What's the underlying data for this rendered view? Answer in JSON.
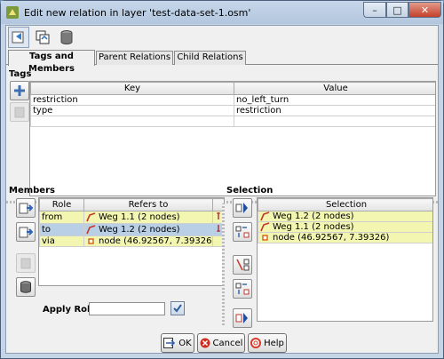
{
  "window": {
    "title": "Edit new relation in layer 'test-data-set-1.osm'"
  },
  "window_controls": {
    "minimize": "–",
    "maximize": "□",
    "close": "✕"
  },
  "toolbar": {
    "icons": [
      "apply-changes-icon",
      "refresh-icon",
      "delete-db-icon"
    ]
  },
  "tabs": [
    {
      "label": "Tags and Members"
    },
    {
      "label": "Parent Relations"
    },
    {
      "label": "Child Relations"
    }
  ],
  "tags": {
    "label": "Tags",
    "columns": [
      "Key",
      "Value"
    ],
    "rows": [
      {
        "key": "restriction",
        "value": "no_left_turn"
      },
      {
        "key": "type",
        "value": "restriction"
      }
    ]
  },
  "members": {
    "label": "Members",
    "columns": [
      "Role",
      "Refers to"
    ],
    "rows": [
      {
        "role": "from",
        "ref": "Weg 1.1 (2 nodes)",
        "type": "way"
      },
      {
        "role": "to",
        "ref": "Weg 1.2 (2 nodes)",
        "type": "way"
      },
      {
        "role": "via",
        "ref": "node (46.92567, 7.39326)",
        "type": "node"
      }
    ],
    "apply_role_label": "Apply Role:",
    "apply_role_value": ""
  },
  "selection": {
    "label": "Selection",
    "column": "Selection",
    "rows": [
      {
        "ref": "Weg 1.2 (2 nodes)",
        "type": "way"
      },
      {
        "ref": "Weg 1.1 (2 nodes)",
        "type": "way"
      },
      {
        "ref": "node (46.92567, 7.39326)",
        "type": "node"
      }
    ]
  },
  "buttons": {
    "ok": "OK",
    "cancel": "Cancel",
    "help": "Help"
  },
  "colors": {
    "highlight_row": "#f2f6b0",
    "selected_row": "#b8cfe5",
    "way_icon": "#c0392b",
    "node_icon": "#d35400"
  }
}
